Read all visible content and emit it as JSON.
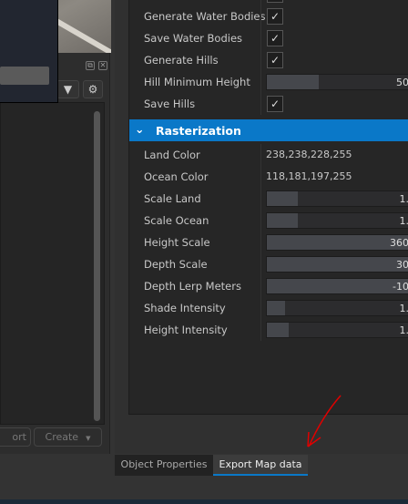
{
  "left_panel": {
    "header_icons": [
      "float-icon",
      "close-icon"
    ],
    "toolbar_icons": [
      "filter-icon",
      "gear-icon"
    ],
    "buttons": {
      "import_label": "ort",
      "create_label": "Create"
    }
  },
  "properties": {
    "rows_top": [
      {
        "label": "Generate Water Bodies",
        "type": "checkbox",
        "checked": true
      },
      {
        "label": "Save Water Bodies",
        "type": "checkbox",
        "checked": true
      },
      {
        "label": "Generate Hills",
        "type": "checkbox",
        "checked": true
      },
      {
        "label": "Hill Minimum Height",
        "type": "slider",
        "value": "50",
        "fill": 0.34
      },
      {
        "label": "Save Hills",
        "type": "checkbox",
        "checked": true
      }
    ],
    "section": {
      "title": "Rasterization",
      "expanded": true,
      "color": "#0a78c8"
    },
    "rows_raster": [
      {
        "label": "Land Color",
        "type": "text",
        "value": "238,238,228,255"
      },
      {
        "label": "Ocean Color",
        "type": "text",
        "value": "118,181,197,255"
      },
      {
        "label": "Scale Land",
        "type": "slider",
        "value": "1.",
        "fill": 0.2
      },
      {
        "label": "Scale Ocean",
        "type": "slider",
        "value": "1.",
        "fill": 0.2
      },
      {
        "label": "Height Scale",
        "type": "slider",
        "value": "360",
        "fill": 1.0
      },
      {
        "label": "Depth Scale",
        "type": "slider",
        "value": "30",
        "fill": 1.0
      },
      {
        "label": "Depth Lerp Meters",
        "type": "slider",
        "value": "-10",
        "fill": 1.0
      },
      {
        "label": "Shade Intensity",
        "type": "slider",
        "value": "1.",
        "fill": 0.12
      },
      {
        "label": "Height Intensity",
        "type": "slider",
        "value": "1.",
        "fill": 0.14
      }
    ]
  },
  "tabs": [
    {
      "label": "Object Properties",
      "active": false
    },
    {
      "label": "Export Map data",
      "active": true
    }
  ],
  "annotation": {
    "type": "red-arrow",
    "color": "#e00000"
  }
}
